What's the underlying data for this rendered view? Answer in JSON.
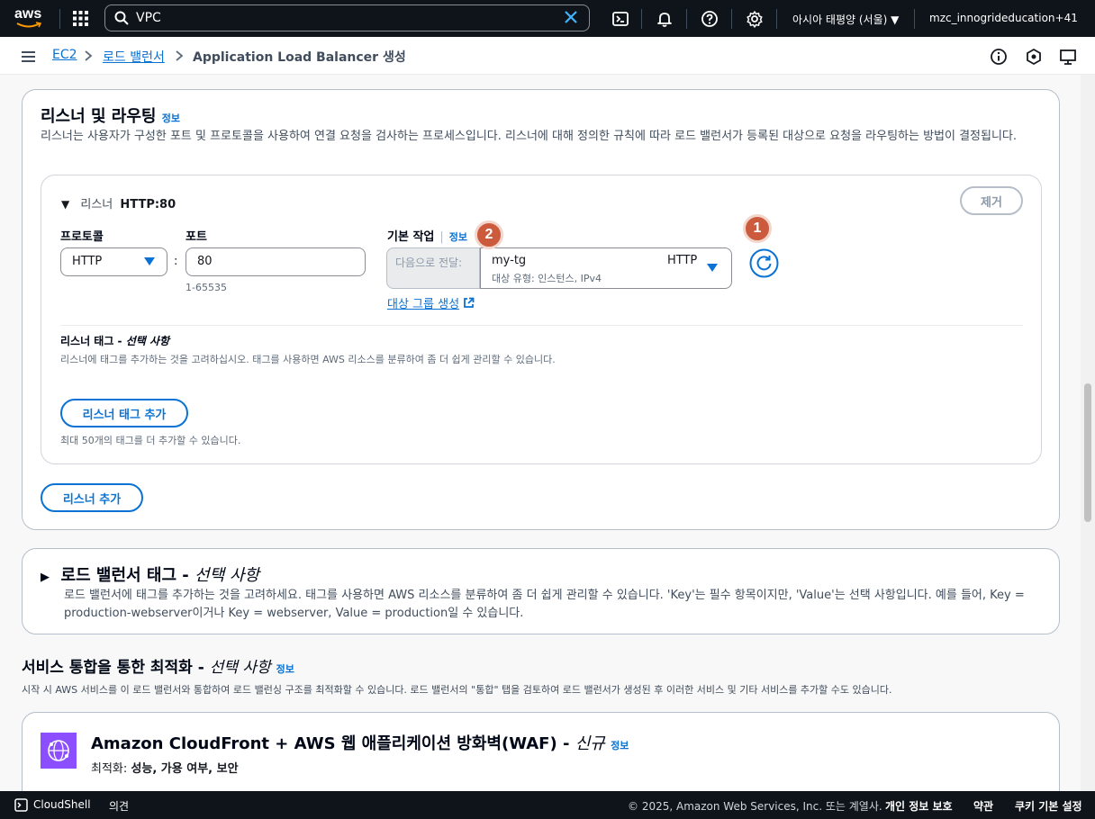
{
  "topbar": {
    "logo_text": "aws",
    "search_value": "VPC",
    "region": "아시아 태평양 (서울)",
    "account": "mzc_innogrideducation+41"
  },
  "breadcrumb": {
    "items": [
      "EC2",
      "로드 밸런서",
      "Application Load Balancer 생성"
    ]
  },
  "listeners_section": {
    "title": "리스너 및 라우팅",
    "info": "정보",
    "description": "리스너는 사용자가 구성한 포트 및 프로토콜을 사용하여 연결 요청을 검사하는 프로세스입니다. 리스너에 대해 정의한 규칙에 따라 로드 밸런서가 등록된 대상으로 요청을 라우팅하는 방법이 결정됩니다.",
    "listener": {
      "prefix": "리스너",
      "name": "HTTP:80",
      "remove_label": "제거",
      "protocol_label": "프로토콜",
      "protocol_value": "HTTP",
      "port_label": "포트",
      "port_value": "80",
      "port_hint": "1-65535",
      "default_action_label": "기본 작업",
      "default_action_info": "정보",
      "forward_label": "다음으로 전달:",
      "target_group_name": "my-tg",
      "target_group_protocol": "HTTP",
      "target_group_detail": "대상 유형: 인스턴스, IPv4",
      "create_target_group": "대상 그룹 생성",
      "tags_title": "리스너 태그 - ",
      "tags_optional": "선택 사항",
      "tags_description": "리스너에 태그를 추가하는 것을 고려하십시오. 태그를 사용하면 AWS 리소스를 분류하여 좀 더 쉽게 관리할 수 있습니다.",
      "add_tag_button": "리스너 태그 추가",
      "tag_limit": "최대 50개의 태그를 더 추가할 수 있습니다."
    },
    "add_listener_button": "리스너 추가"
  },
  "badges": [
    "1",
    "2"
  ],
  "lb_tags_section": {
    "title": "로드 밸런서 태그 - ",
    "optional": "선택 사항",
    "description": "로드 밸런서에 태그를 추가하는 것을 고려하세요. 태그를 사용하면 AWS 리소스를 분류하여 좀 더 쉽게 관리할 수 있습니다. 'Key'는 필수 항목이지만, 'Value'는 선택 사항입니다. 예를 들어, Key = production-webserver이거나 Key = webserver, Value = production일 수 있습니다."
  },
  "integration_section": {
    "title": "서비스 통합을 통한 최적화 - ",
    "optional": "선택 사항",
    "info": "정보",
    "description": "시작 시 AWS 서비스를 이 로드 밸런서와 통합하여 로드 밸런싱 구조를 최적화할 수 있습니다. 로드 밸런서의 \"통합\" 탭을 검토하여 로드 밸런서가 생성된 후 이러한 서비스 및 기타 서비스를 추가할 수도 있습니다.",
    "card_title": "Amazon CloudFront + AWS 웹 애플리케이션 방화벽(WAF) - ",
    "card_new": "신규",
    "card_info": "정보",
    "card_optimize_label": "최적화: ",
    "card_optimize_value": "성능, 가용 여부, 보안"
  },
  "footer": {
    "cloudshell": "CloudShell",
    "feedback": "의견",
    "copyright": "© 2025, Amazon Web Services, Inc. 또는 계열사.",
    "privacy": "개인 정보 보호",
    "terms": "약관",
    "cookies": "쿠키 기본 설정"
  },
  "colors": {
    "topbar": "#0f141a",
    "link": "#0972d3",
    "badge": "#cb5b3c"
  }
}
